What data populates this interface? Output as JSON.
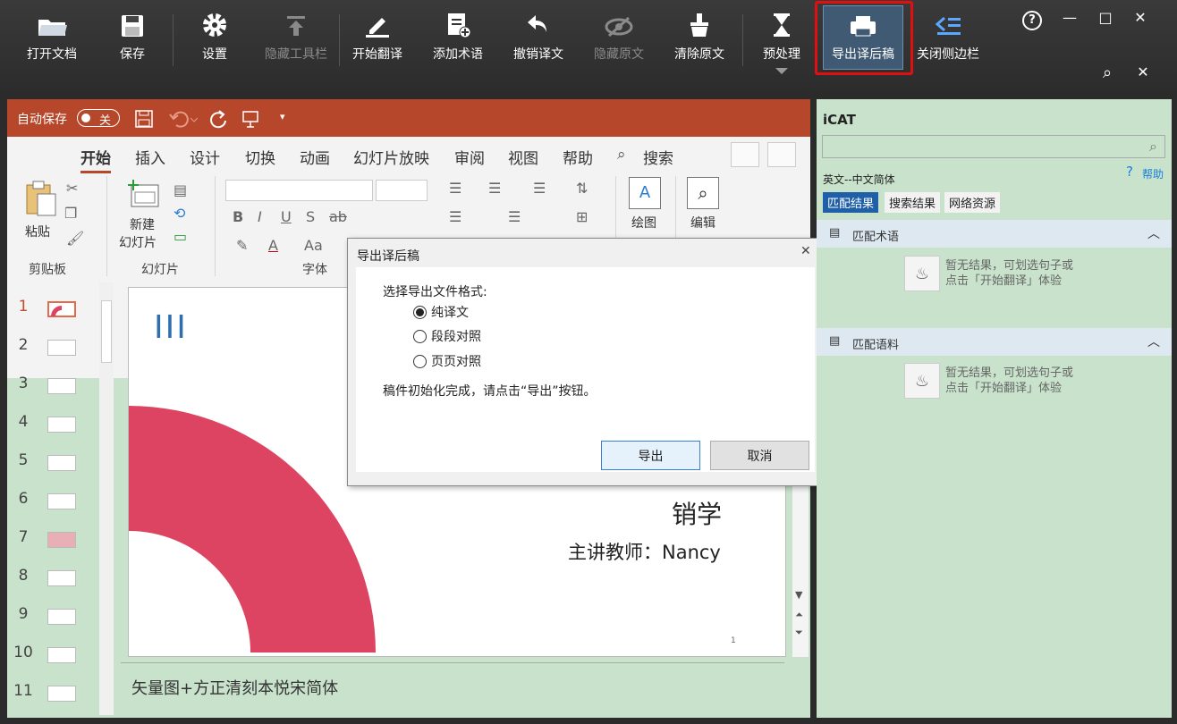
{
  "toolbar": {
    "open": "打开文档",
    "save": "保存",
    "settings": "设置",
    "hide_toolbar": "隐藏工具栏",
    "start_translate": "开始翻译",
    "add_term": "添加术语",
    "undo_translation": "撤销译文",
    "hide_source": "隐藏原文",
    "clear_source": "清除原文",
    "preprocess": "预处理",
    "export_draft": "导出译后稿",
    "close_sidebar": "关闭侧边栏"
  },
  "window_controls": {
    "help": "?",
    "minimize": "—",
    "maximize": "□",
    "close": "✕",
    "search": "⌕",
    "close2": "✕"
  },
  "ppt": {
    "autosave": "自动保存",
    "autosave_state": "关",
    "tabs": [
      "开始",
      "插入",
      "设计",
      "切换",
      "动画",
      "幻灯片放映",
      "审阅",
      "视图",
      "帮助",
      "搜索"
    ],
    "groups": {
      "clipboard": "剪贴板",
      "slides": "幻灯片",
      "font": "字体"
    },
    "paste": "粘贴",
    "new_slide_1": "新建",
    "new_slide_2": "幻灯片",
    "draw": "绘图",
    "edit": "编辑",
    "slide_numbers": [
      "1",
      "2",
      "3",
      "4",
      "5",
      "6",
      "7",
      "8",
      "9",
      "10",
      "11"
    ],
    "slide": {
      "mark": "III",
      "line1": "销学",
      "line2": "主讲教师：Nancy",
      "page": "1"
    },
    "notes": "矢量图+方正清刻本悦宋简体"
  },
  "dialog": {
    "title": "导出译后稿",
    "prompt": "选择导出文件格式:",
    "options": [
      "纯译文",
      "段段对照",
      "页页对照"
    ],
    "selected": 0,
    "status": "稿件初始化完成，请点击“导出”按钮。",
    "export": "导出",
    "cancel": "取消"
  },
  "sidebar": {
    "title": "iCAT",
    "lang": "英文--中文简体",
    "help": "帮助",
    "tabs": [
      "匹配结果",
      "搜索结果",
      "网络资源"
    ],
    "sections": [
      "匹配术语",
      "匹配语料"
    ],
    "empty_line1": "暂无结果，可划选句子或",
    "empty_line2": "点击「开始翻译」体验"
  },
  "colors": {
    "ppt_accent": "#b7472a",
    "sidebar_bg": "#c8e2cb",
    "highlight": "#e01010",
    "slide_arc": "#dd4461"
  }
}
